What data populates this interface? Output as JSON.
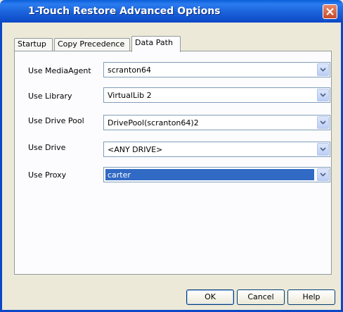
{
  "window": {
    "title": "1-Touch Restore Advanced Options"
  },
  "tabs": [
    {
      "label": "Startup"
    },
    {
      "label": "Copy Precedence"
    },
    {
      "label": "Data Path",
      "active": true
    }
  ],
  "fields": {
    "media_agent": {
      "label": "Use MediaAgent",
      "value": "scranton64"
    },
    "library": {
      "label": "Use Library",
      "value": "VirtualLib 2"
    },
    "drive_pool": {
      "label": "Use Drive Pool",
      "value": "DrivePool(scranton64)2"
    },
    "drive": {
      "label": "Use Drive",
      "value": "<ANY DRIVE>"
    },
    "proxy": {
      "label": "Use Proxy",
      "value": "carter"
    }
  },
  "buttons": {
    "ok": "OK",
    "cancel": "Cancel",
    "help": "Help"
  },
  "colors": {
    "titlebar": "#0b47c7",
    "selection": "#316ac5",
    "dialog_bg": "#ece9d8"
  },
  "icons": {
    "close": "close-icon",
    "dropdown": "chevron-down-icon"
  }
}
